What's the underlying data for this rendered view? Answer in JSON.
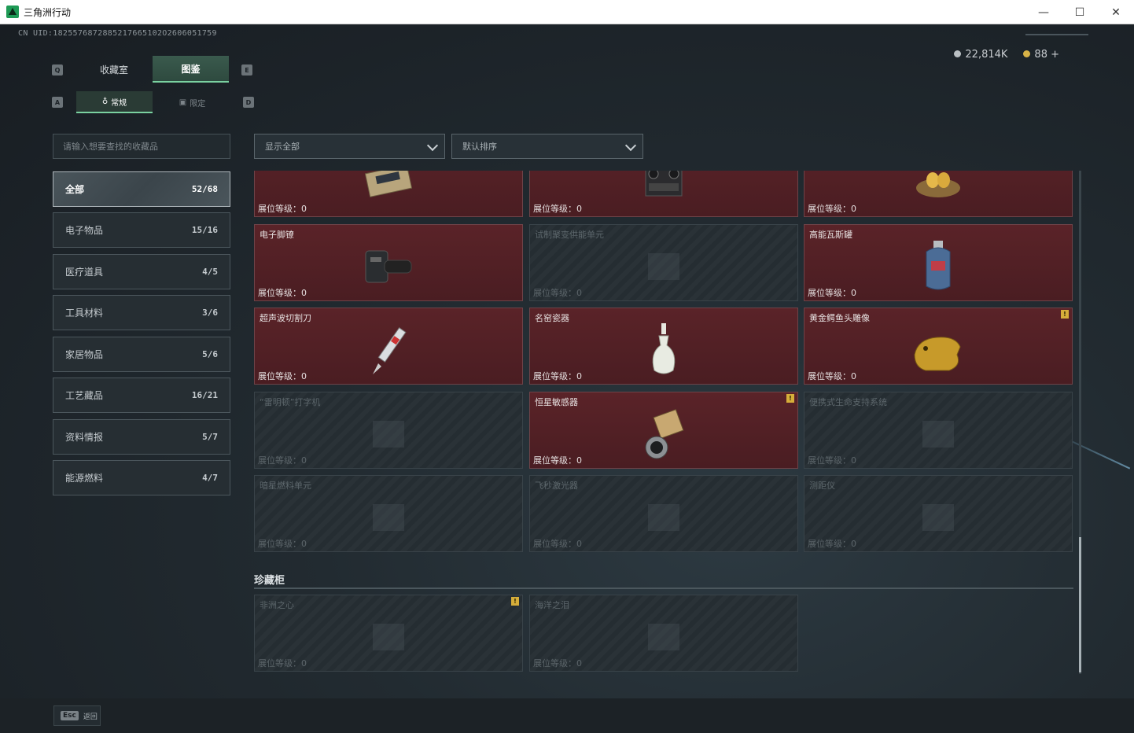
{
  "window": {
    "title": "三角洲行动",
    "minimize": "—",
    "maximize": "☐",
    "close": "✕"
  },
  "uid": "CN UID:1825576872885217665102O2606051759",
  "currency": {
    "silver": "22,814K",
    "gold": "88 +"
  },
  "tabs": {
    "key_left": "Q",
    "key_right": "E",
    "items": [
      {
        "label": "收藏室"
      },
      {
        "label": "图鉴"
      }
    ]
  },
  "subtabs": {
    "key_left": "A",
    "key_right": "D",
    "items": [
      {
        "label": "常规"
      },
      {
        "label": "限定"
      }
    ]
  },
  "search": {
    "placeholder": "请输入想要查找的收藏品"
  },
  "filters": {
    "show": "显示全部",
    "sort": "默认排序"
  },
  "categories": [
    {
      "label": "全部",
      "count": "52/68"
    },
    {
      "label": "电子物品",
      "count": "15/16"
    },
    {
      "label": "医疗道具",
      "count": "4/5"
    },
    {
      "label": "工具材料",
      "count": "3/6"
    },
    {
      "label": "家居物品",
      "count": "5/6"
    },
    {
      "label": "工艺藏品",
      "count": "16/21"
    },
    {
      "label": "资料情报",
      "count": "5/7"
    },
    {
      "label": "能源燃料",
      "count": "4/7"
    }
  ],
  "level_label": "展位等级：0",
  "items": [
    {
      "name": "",
      "owned": true
    },
    {
      "name": "",
      "owned": true
    },
    {
      "name": "",
      "owned": true
    },
    {
      "name": "电子脚镣",
      "owned": true
    },
    {
      "name": "试制聚变供能单元",
      "owned": false
    },
    {
      "name": "高能瓦斯罐",
      "owned": true
    },
    {
      "name": "超声波切割刀",
      "owned": true
    },
    {
      "name": "名窑瓷器",
      "owned": true
    },
    {
      "name": "黄金鳄鱼头雕像",
      "owned": true,
      "badge": "!"
    },
    {
      "name": "“雷明顿”打字机",
      "owned": false
    },
    {
      "name": "恒星敏感器",
      "owned": true,
      "badge": "!"
    },
    {
      "name": "便携式生命支持系统",
      "owned": false
    },
    {
      "name": "暗星燃料单元",
      "owned": false
    },
    {
      "name": "飞秒激光器",
      "owned": false
    },
    {
      "name": "测距仪",
      "owned": false
    }
  ],
  "section": {
    "title": "珍藏柜"
  },
  "treasure_items": [
    {
      "name": "非洲之心",
      "owned": false,
      "badge": "!"
    },
    {
      "name": "海洋之泪",
      "owned": false
    }
  ],
  "footer": {
    "key": "Esc",
    "label": "返回"
  },
  "colors": {
    "accent": "#7ad1a0",
    "owned_card": "#4f1f24",
    "badge": "#d6ae3a"
  }
}
